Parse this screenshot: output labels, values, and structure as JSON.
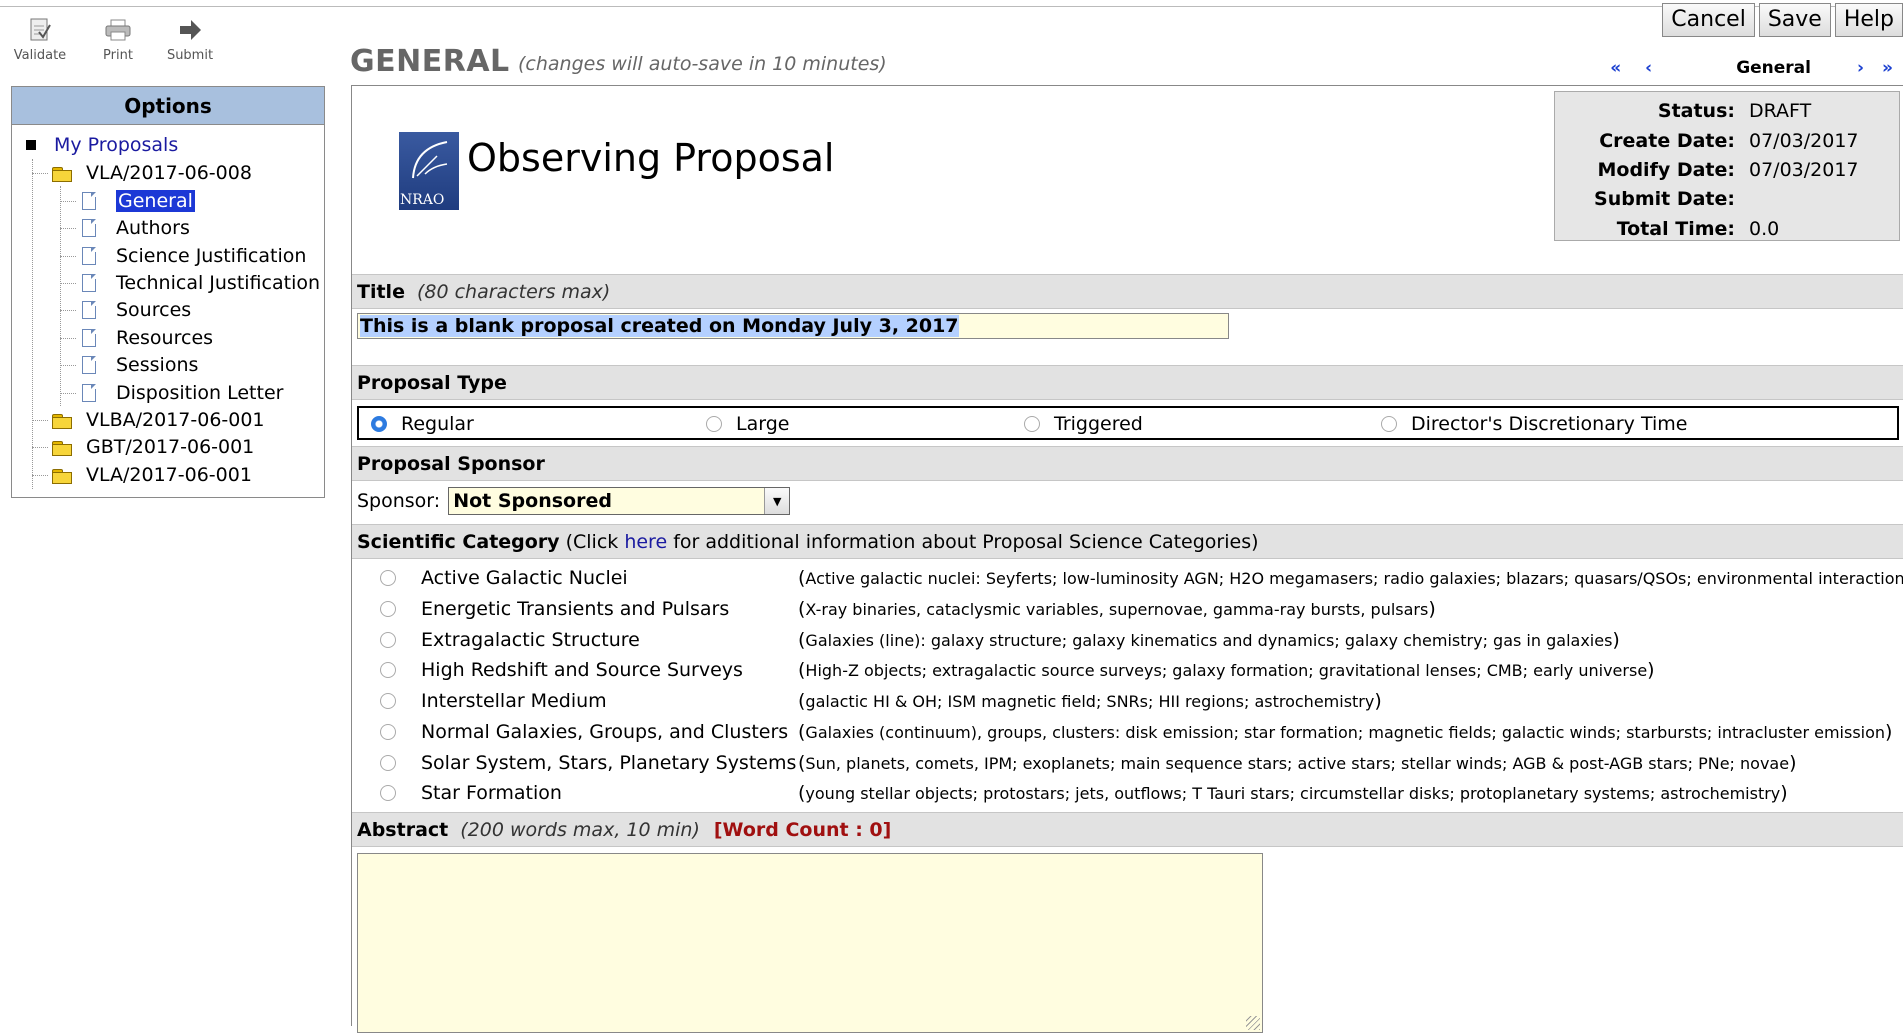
{
  "toolbar": {
    "validate": "Validate",
    "print": "Print",
    "submit": "Submit"
  },
  "actions": {
    "cancel": "Cancel",
    "save": "Save",
    "help": "Help"
  },
  "options": {
    "heading": "Options",
    "root": "My Proposals",
    "proposals": [
      {
        "label": "VLA/2017-06-008"
      },
      {
        "label": "VLBA/2017-06-001"
      },
      {
        "label": "GBT/2017-06-001"
      },
      {
        "label": "VLA/2017-06-001"
      }
    ],
    "sections": [
      "General",
      "Authors",
      "Science Justification",
      "Technical Justification",
      "Sources",
      "Resources",
      "Sessions",
      "Disposition Letter"
    ]
  },
  "header": {
    "title": "GENERAL",
    "subtitle": "(changes will auto-save in 10 minutes)"
  },
  "pager": {
    "first": "«",
    "prev": "‹",
    "current": "General",
    "next": "›",
    "last": "»"
  },
  "proposal": {
    "heading": "Observing Proposal",
    "logo_text": "NRAO"
  },
  "status": {
    "status_label": "Status:",
    "status_value": "DRAFT",
    "create_label": "Create Date:",
    "create_value": "07/03/2017",
    "modify_label": "Modify Date:",
    "modify_value": "07/03/2017",
    "submit_label": "Submit Date:",
    "submit_value": "",
    "total_label": "Total Time:",
    "total_value": "0.0"
  },
  "title_section": {
    "label": "Title",
    "hint": "(80 characters max)",
    "value": "This is a blank proposal created on Monday July 3, 2017"
  },
  "proposal_type": {
    "label": "Proposal Type",
    "options": [
      "Regular",
      "Large",
      "Triggered",
      "Director's Discretionary Time"
    ],
    "selected": "Regular"
  },
  "sponsor": {
    "section_label": "Proposal Sponsor",
    "field_label": "Sponsor:",
    "value": "Not Sponsored"
  },
  "category": {
    "label": "Scientific Category",
    "pre": "(Click",
    "link": "here",
    "post": "for additional information about Proposal Science Categories)",
    "items": [
      {
        "name": "Active Galactic Nuclei",
        "desc": "Active galactic nuclei: Seyferts; low-luminosity AGN; H2O megamasers; radio galaxies; blazars; quasars/QSOs; environmental interactions"
      },
      {
        "name": "Energetic Transients and Pulsars",
        "desc": "X-ray binaries, cataclysmic variables, supernovae, gamma-ray bursts, pulsars"
      },
      {
        "name": "Extragalactic Structure",
        "desc": "Galaxies (line): galaxy structure; galaxy kinematics and dynamics; galaxy chemistry; gas in galaxies"
      },
      {
        "name": "High Redshift and Source Surveys",
        "desc": "High-Z objects; extragalactic source surveys; galaxy formation; gravitational lenses; CMB; early universe"
      },
      {
        "name": "Interstellar Medium",
        "desc": "galactic HI & OH; ISM magnetic field; SNRs; HII regions; astrochemistry"
      },
      {
        "name": "Normal Galaxies, Groups, and Clusters",
        "desc": "Galaxies (continuum), groups, clusters: disk emission; star formation; magnetic fields; galactic winds; starbursts; intracluster emission"
      },
      {
        "name": "Solar System, Stars, Planetary Systems",
        "desc": "Sun, planets, comets, IPM; exoplanets; main sequence stars; active stars; stellar winds; AGB & post-AGB stars; PNe; novae"
      },
      {
        "name": "Star Formation",
        "desc": "young stellar objects; protostars; jets, outflows; T Tauri stars; circumstellar disks; protoplanetary systems; astrochemistry"
      }
    ]
  },
  "abstract": {
    "label": "Abstract",
    "hint": "(200 words max, 10 min)",
    "word_count": "[Word Count : 0]",
    "value": ""
  }
}
